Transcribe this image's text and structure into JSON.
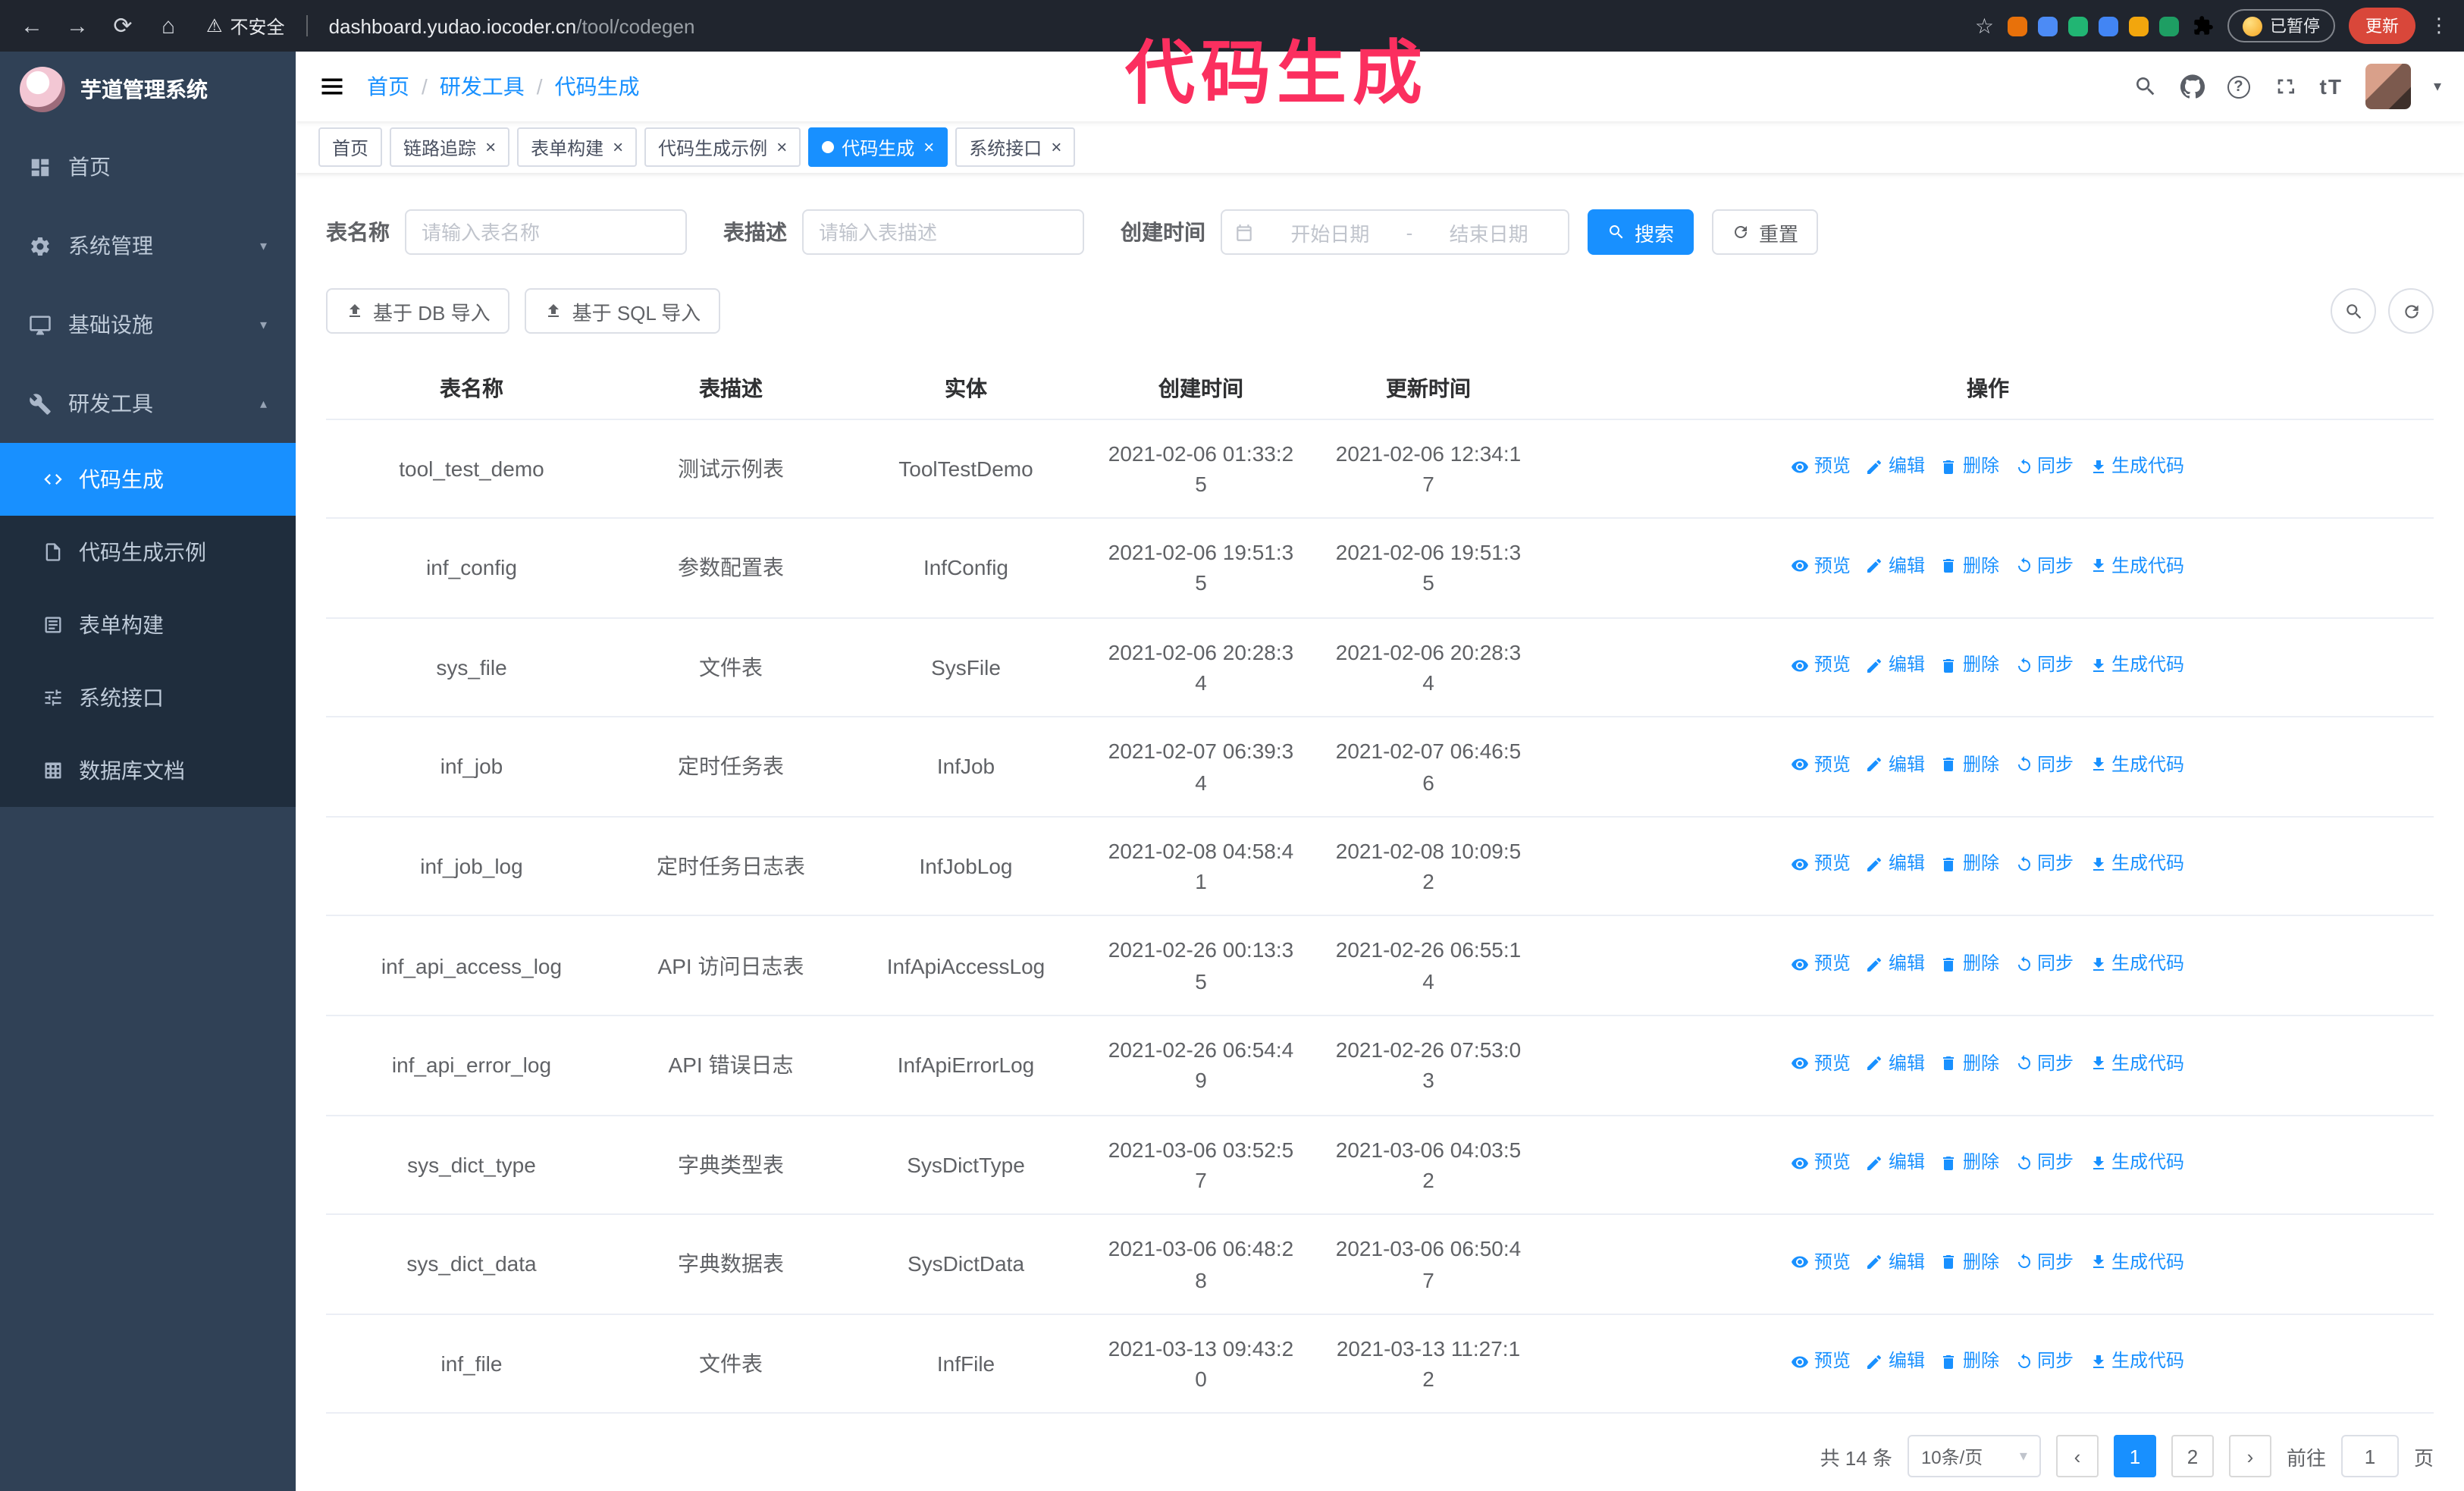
{
  "colors": {
    "accent": "#1890ff",
    "sidebar_bg": "#304156",
    "submenu_bg": "#1f2d3d",
    "annotation": "#fb2f5f",
    "update_button": "#d9473a"
  },
  "annotation": {
    "text": "代码生成"
  },
  "browser": {
    "security_label": "不安全",
    "url_host": "dashboard.yudao.iocoder.cn",
    "url_path": "/tool/codegen",
    "extensions": [
      "#e8710a",
      "#4c8bf5",
      "#21b573",
      "#4285f4",
      "#f2a60d",
      "#1e9e63"
    ],
    "paused_badge": "已暂停",
    "update_button": "更新"
  },
  "sidebar": {
    "logo_title": "芋道管理系统",
    "menu": [
      {
        "key": "home",
        "label": "首页",
        "icon": "dashboard"
      },
      {
        "key": "system",
        "label": "系统管理",
        "icon": "gear",
        "chevron": "down"
      },
      {
        "key": "infra",
        "label": "基础设施",
        "icon": "monitor",
        "chevron": "down"
      },
      {
        "key": "dev-tools",
        "label": "研发工具",
        "icon": "tools",
        "chevron": "up",
        "children": [
          {
            "key": "codegen",
            "label": "代码生成",
            "icon": "code",
            "active": true
          },
          {
            "key": "codegen-example",
            "label": "代码生成示例",
            "icon": "doc"
          },
          {
            "key": "form-builder",
            "label": "表单构建",
            "icon": "form"
          },
          {
            "key": "api",
            "label": "系统接口",
            "icon": "sliders"
          },
          {
            "key": "db-doc",
            "label": "数据库文档",
            "icon": "grid"
          }
        ]
      }
    ]
  },
  "header": {
    "breadcrumb": [
      "首页",
      "研发工具",
      "代码生成"
    ]
  },
  "tags": [
    {
      "label": "首页",
      "closable": false,
      "active": false
    },
    {
      "label": "链路追踪",
      "closable": true,
      "active": false
    },
    {
      "label": "表单构建",
      "closable": true,
      "active": false
    },
    {
      "label": "代码生成示例",
      "closable": true,
      "active": false
    },
    {
      "label": "代码生成",
      "closable": true,
      "active": true
    },
    {
      "label": "系统接口",
      "closable": true,
      "active": false
    }
  ],
  "filters": {
    "table_name_label": "表名称",
    "table_name_placeholder": "请输入表名称",
    "table_desc_label": "表描述",
    "table_desc_placeholder": "请输入表描述",
    "create_time_label": "创建时间",
    "start_placeholder": "开始日期",
    "range_separator": "-",
    "end_placeholder": "结束日期",
    "search_button": "搜索",
    "reset_button": "重置"
  },
  "toolbar": {
    "import_db": "基于 DB 导入",
    "import_sql": "基于 SQL 导入"
  },
  "table": {
    "columns": [
      "表名称",
      "表描述",
      "实体",
      "创建时间",
      "更新时间",
      "操作"
    ],
    "actions": [
      "预览",
      "编辑",
      "删除",
      "同步",
      "生成代码"
    ],
    "action_icons": [
      "eye",
      "edit",
      "delete",
      "sync",
      "download"
    ],
    "rows": [
      {
        "name": "tool_test_demo",
        "desc": "测试示例表",
        "entity": "ToolTestDemo",
        "created": "2021-02-06 01:33:25",
        "updated": "2021-02-06 12:34:17"
      },
      {
        "name": "inf_config",
        "desc": "参数配置表",
        "entity": "InfConfig",
        "created": "2021-02-06 19:51:35",
        "updated": "2021-02-06 19:51:35"
      },
      {
        "name": "sys_file",
        "desc": "文件表",
        "entity": "SysFile",
        "created": "2021-02-06 20:28:34",
        "updated": "2021-02-06 20:28:34"
      },
      {
        "name": "inf_job",
        "desc": "定时任务表",
        "entity": "InfJob",
        "created": "2021-02-07 06:39:34",
        "updated": "2021-02-07 06:46:56"
      },
      {
        "name": "inf_job_log",
        "desc": "定时任务日志表",
        "entity": "InfJobLog",
        "created": "2021-02-08 04:58:41",
        "updated": "2021-02-08 10:09:52"
      },
      {
        "name": "inf_api_access_log",
        "desc": "API 访问日志表",
        "entity": "InfApiAccessLog",
        "created": "2021-02-26 00:13:35",
        "updated": "2021-02-26 06:55:14"
      },
      {
        "name": "inf_api_error_log",
        "desc": "API 错误日志",
        "entity": "InfApiErrorLog",
        "created": "2021-02-26 06:54:49",
        "updated": "2021-02-26 07:53:03"
      },
      {
        "name": "sys_dict_type",
        "desc": "字典类型表",
        "entity": "SysDictType",
        "created": "2021-03-06 03:52:57",
        "updated": "2021-03-06 04:03:52"
      },
      {
        "name": "sys_dict_data",
        "desc": "字典数据表",
        "entity": "SysDictData",
        "created": "2021-03-06 06:48:28",
        "updated": "2021-03-06 06:50:47"
      },
      {
        "name": "inf_file",
        "desc": "文件表",
        "entity": "InfFile",
        "created": "2021-03-13 09:43:20",
        "updated": "2021-03-13 11:27:12"
      }
    ]
  },
  "pagination": {
    "total_text": "共 14 条",
    "page_size": "10条/页",
    "prev": "‹",
    "next": "›",
    "pages": [
      "1",
      "2"
    ],
    "active_page": "1",
    "goto_label": "前往",
    "goto_value": "1",
    "goto_suffix": "页"
  }
}
